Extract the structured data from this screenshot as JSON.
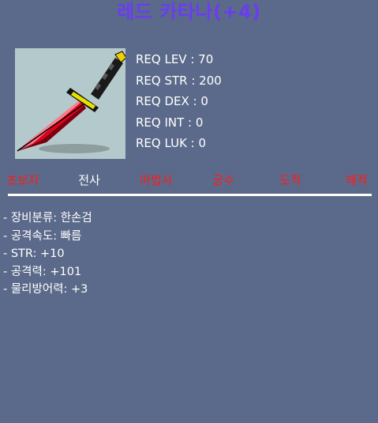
{
  "item": {
    "name": "레드 카타나(+4)",
    "icon": "red-katana-icon"
  },
  "requirements": [
    {
      "label": "REQ LEV : 70"
    },
    {
      "label": "REQ STR : 200"
    },
    {
      "label": "REQ DEX : 0"
    },
    {
      "label": "REQ INT : 0"
    },
    {
      "label": "REQ LUK : 0"
    }
  ],
  "jobs": [
    {
      "label": "초보자",
      "active": false
    },
    {
      "label": "전사",
      "active": true
    },
    {
      "label": "마법사",
      "active": false
    },
    {
      "label": "궁수",
      "active": false
    },
    {
      "label": "도적",
      "active": false
    },
    {
      "label": "해적",
      "active": false
    }
  ],
  "stats": [
    {
      "text": "- 장비분류: 한손검"
    },
    {
      "text": "- 공격속도: 빠름"
    },
    {
      "text": "- STR: +10"
    },
    {
      "text": "- 공격력: +101"
    },
    {
      "text": "- 물리방어력: +3"
    }
  ],
  "colors": {
    "background": "#5b6a8a",
    "title": "#6a3df0",
    "active_job": "#ffffff",
    "inactive_job": "#ff1a1a",
    "icon_bg": "#b4c9cb"
  }
}
